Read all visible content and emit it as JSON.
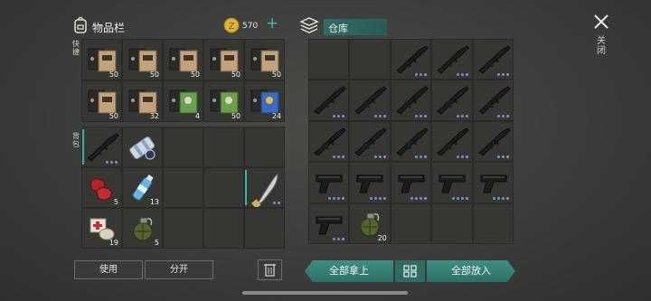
{
  "inventory": {
    "title": "物品栏",
    "coins": "570",
    "add_label": "+",
    "quick_label": "快捷",
    "backpack_label": "背包"
  },
  "warehouse": {
    "title": "仓库"
  },
  "close_label": "关闭",
  "actions": {
    "use": "使用",
    "split": "分开",
    "take_all": "全部拿上",
    "put_all": "全部放入"
  },
  "colors": {
    "accent_teal": "#2fb6a6",
    "coin_gold": "#e0b43a",
    "dot_purple": "#9a86d8",
    "dot_blue": "#6a8ee0"
  },
  "quick_slots": [
    {
      "icon": "book-tan-icon",
      "count": "50"
    },
    {
      "icon": "book-tan-icon",
      "count": "50"
    },
    {
      "icon": "book-tan-icon",
      "count": "50"
    },
    {
      "icon": "book-tan-icon",
      "count": "50"
    },
    {
      "icon": "book-tan-icon",
      "count": "50"
    },
    {
      "icon": "book-tan-icon",
      "count": "50"
    },
    {
      "icon": "book-tan-icon",
      "count": "32"
    },
    {
      "icon": "book-green-icon",
      "count": "4"
    },
    {
      "icon": "book-green-icon",
      "count": "50"
    },
    {
      "icon": "book-blue-icon",
      "count": "24"
    }
  ],
  "backpack_slots": [
    {
      "icon": "rifle-icon",
      "count": "",
      "dots": 3,
      "selected": true
    },
    {
      "icon": "bandage-roll-icon",
      "count": "",
      "dots": 0
    },
    {
      "icon": "",
      "count": ""
    },
    {
      "icon": "",
      "count": ""
    },
    {
      "icon": "",
      "count": ""
    },
    {
      "icon": "meat-icon",
      "count": "5"
    },
    {
      "icon": "water-bottle-icon",
      "count": "13"
    },
    {
      "icon": "",
      "count": ""
    },
    {
      "icon": "",
      "count": ""
    },
    {
      "icon": "machete-icon",
      "count": "",
      "dots": 2,
      "selected": true
    },
    {
      "icon": "medkit-bandage-icon",
      "count": "19"
    },
    {
      "icon": "grenade-icon",
      "count": "5"
    },
    {
      "icon": "",
      "count": ""
    },
    {
      "icon": "",
      "count": ""
    },
    {
      "icon": "",
      "count": ""
    }
  ],
  "warehouse_slots": [
    {
      "icon": "",
      "count": ""
    },
    {
      "icon": "",
      "count": ""
    },
    {
      "icon": "rifle-icon",
      "count": "",
      "dots": 3
    },
    {
      "icon": "rifle-icon",
      "count": "",
      "dots": 3
    },
    {
      "icon": "rifle-icon",
      "count": "",
      "dots": 3
    },
    {
      "icon": "rifle-icon",
      "count": "",
      "dots": 3
    },
    {
      "icon": "rifle-icon",
      "count": "",
      "dots": 3
    },
    {
      "icon": "rifle-icon",
      "count": "",
      "dots": 3
    },
    {
      "icon": "rifle-icon",
      "count": "",
      "dots": 3
    },
    {
      "icon": "rifle-icon",
      "count": "",
      "dots": 3
    },
    {
      "icon": "rifle-icon",
      "count": "",
      "dots": 3
    },
    {
      "icon": "rifle-icon",
      "count": "",
      "dots": 3
    },
    {
      "icon": "rifle-icon",
      "count": "",
      "dots": 3
    },
    {
      "icon": "rifle-icon",
      "count": "",
      "dots": 3
    },
    {
      "icon": "rifle-icon",
      "count": "",
      "dots": 3
    },
    {
      "icon": "pistol-icon",
      "count": "",
      "dots": 4
    },
    {
      "icon": "pistol-icon",
      "count": "",
      "dots": 4
    },
    {
      "icon": "pistol-icon",
      "count": "",
      "dots": 4
    },
    {
      "icon": "pistol-icon",
      "count": "",
      "dots": 4
    },
    {
      "icon": "pistol-icon",
      "count": "",
      "dots": 4
    },
    {
      "icon": "pistol-icon",
      "count": "",
      "dots": 3
    },
    {
      "icon": "grenade-icon",
      "count": "20"
    },
    {
      "icon": "",
      "count": ""
    },
    {
      "icon": "",
      "count": ""
    },
    {
      "icon": "",
      "count": ""
    }
  ]
}
